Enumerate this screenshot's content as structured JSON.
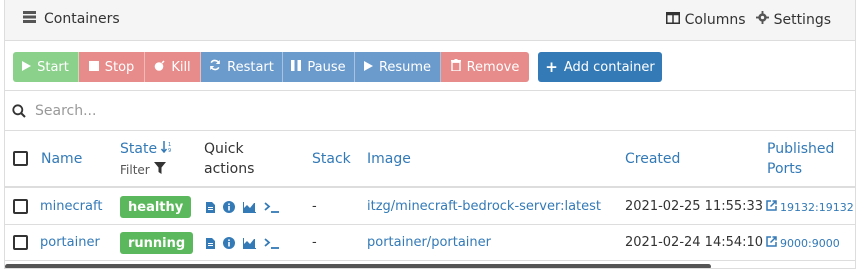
{
  "header": {
    "title": "Containers",
    "columns_label": "Columns",
    "settings_label": "Settings"
  },
  "toolbar": {
    "start": "Start",
    "stop": "Stop",
    "kill": "Kill",
    "restart": "Restart",
    "pause": "Pause",
    "resume": "Resume",
    "remove": "Remove",
    "add_container": "Add container"
  },
  "search": {
    "placeholder": "Search..."
  },
  "table": {
    "columns": {
      "name": "Name",
      "state": "State",
      "state_filter": "Filter",
      "quick_actions_1": "Quick",
      "quick_actions_2": "actions",
      "stack": "Stack",
      "image": "Image",
      "created": "Created",
      "published_1": "Published",
      "published_2": "Ports"
    },
    "rows": [
      {
        "name": "minecraft",
        "state": "healthy",
        "stack": "-",
        "image": "itzg/minecraft-bedrock-server:latest",
        "created": "2021-02-25 11:55:33",
        "ports": "19132:19132"
      },
      {
        "name": "portainer",
        "state": "running",
        "stack": "-",
        "image": "portainer/portainer",
        "created": "2021-02-24 14:54:10",
        "ports": "9000:9000"
      }
    ]
  },
  "colors": {
    "accent": "#337ab7",
    "success": "#5cb85c",
    "header_bg": "#f5f5f5"
  }
}
